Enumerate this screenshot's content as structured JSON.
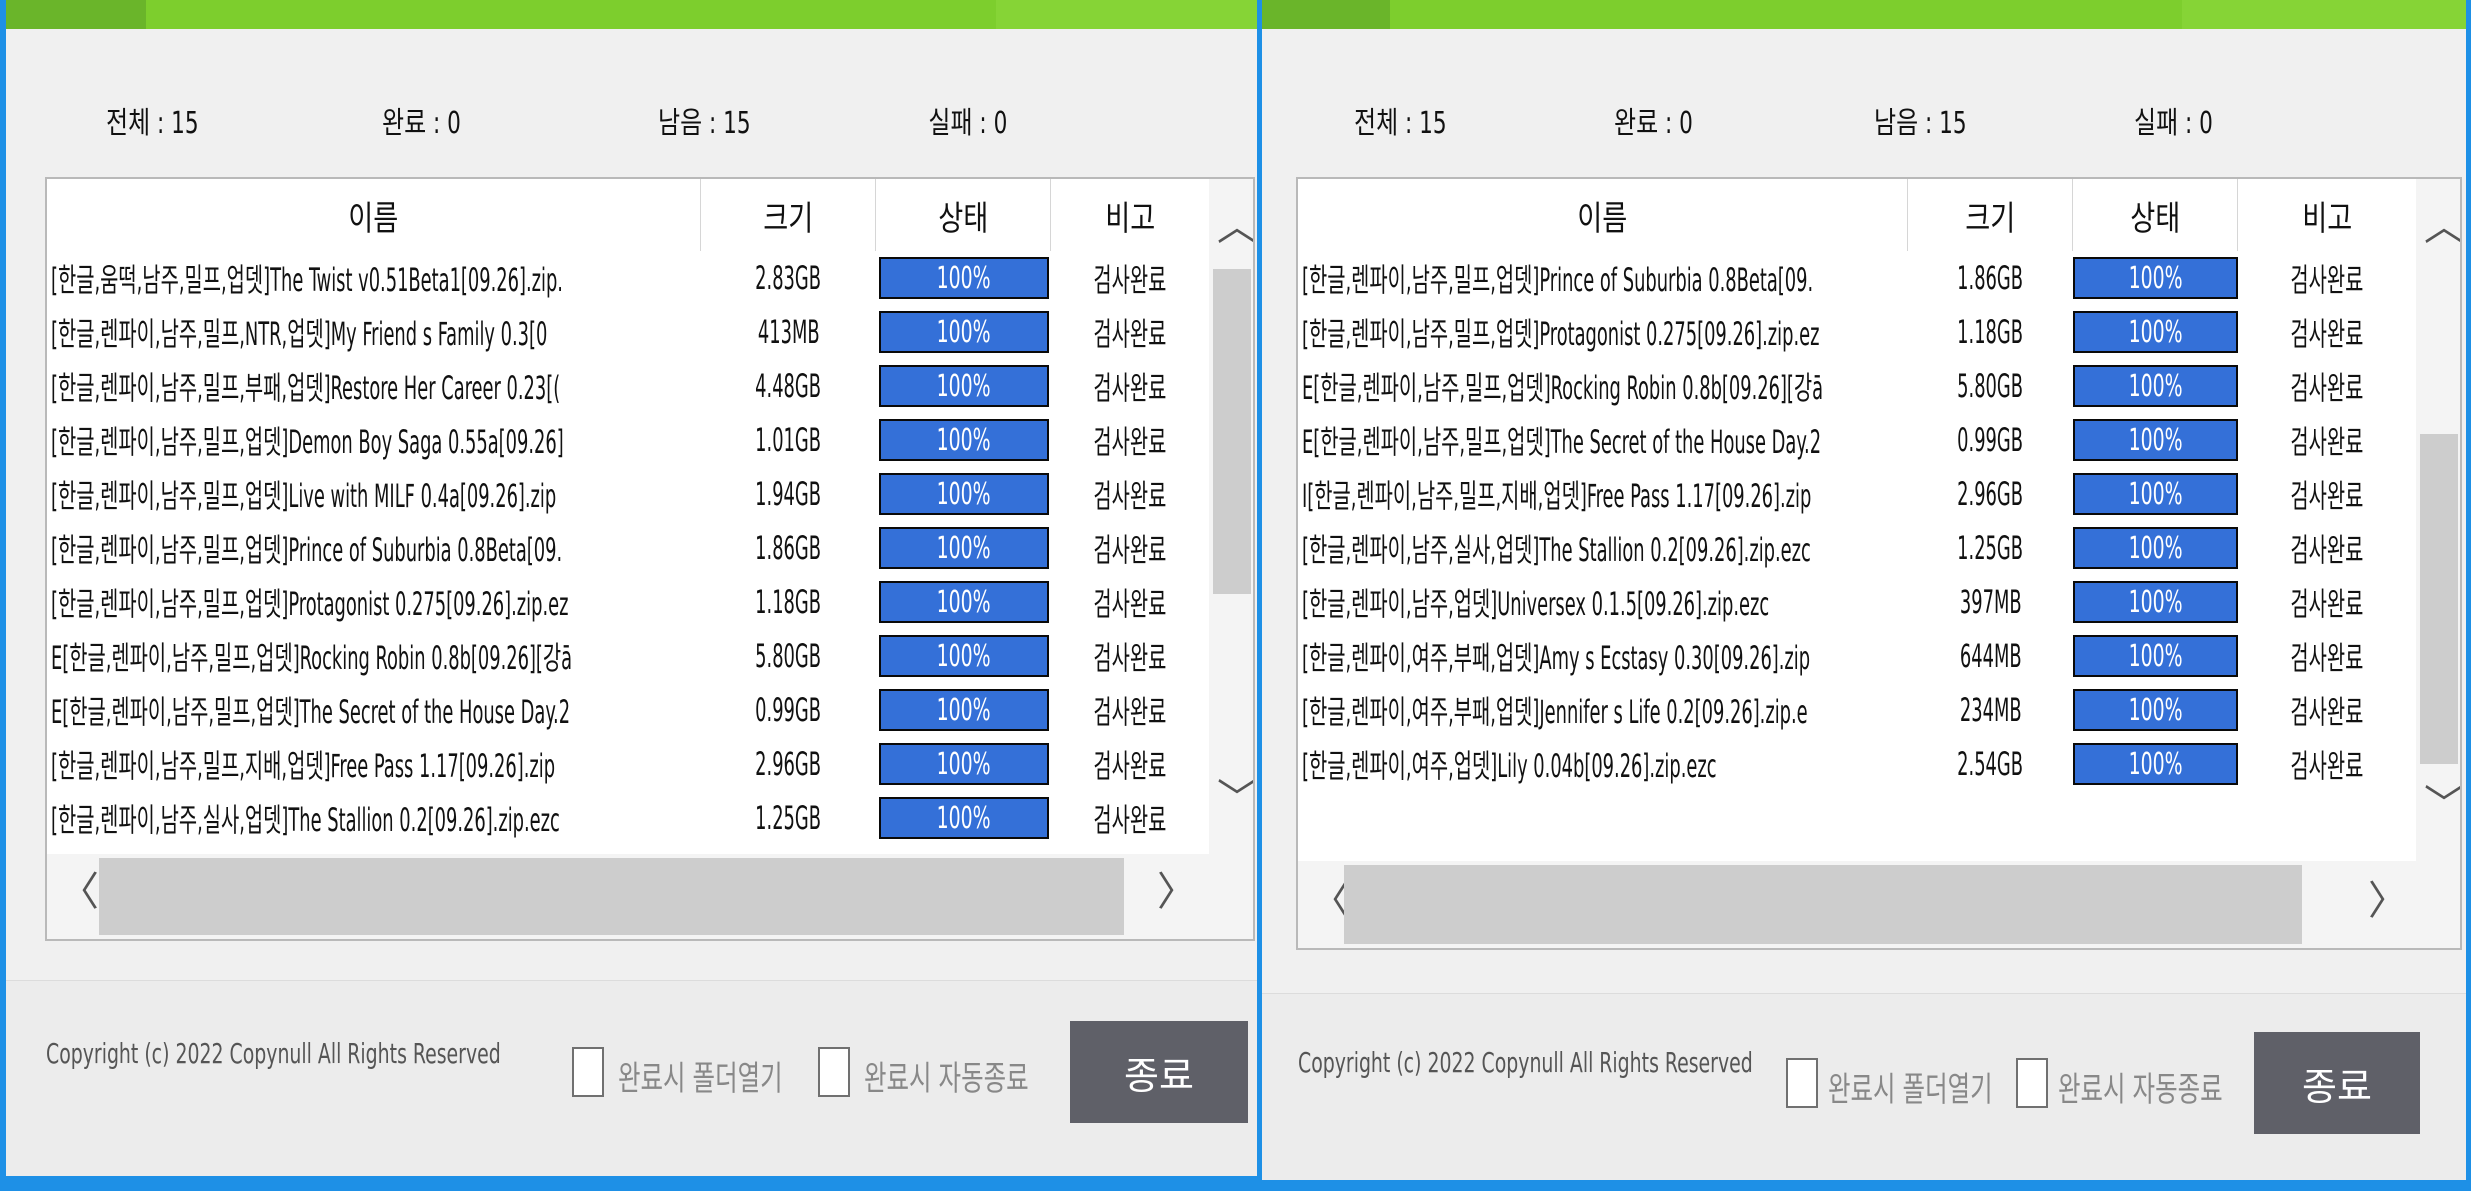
{
  "stats_labels": {
    "total": "전체",
    "done": "완료",
    "remaining": "남음",
    "failed": "실패",
    "sep": ":"
  },
  "columns": {
    "name": "이름",
    "size": "크기",
    "status": "상태",
    "note": "비고"
  },
  "left": {
    "stats": {
      "total": "15",
      "done": "0",
      "remaining": "15",
      "failed": "0"
    },
    "rows": [
      {
        "name": "[한글,움떡,남주,밀프,업뎃]The Twist v0.51Beta1[09.26].zip.",
        "size": "2.83GB",
        "status": "100%",
        "note": "검사완료"
      },
      {
        "name": "[한글,렌파이,남주,밀프,NTR,업뎃]My Friend s Family 0.3[0",
        "size": "413MB",
        "status": "100%",
        "note": "검사완료"
      },
      {
        "name": "[한글,렌파이,남주,밀프,부패,업뎃]Restore Her Career 0.23[(",
        "size": "4.48GB",
        "status": "100%",
        "note": "검사완료"
      },
      {
        "name": "[한글,렌파이,남주,밀프,업뎃]Demon Boy Saga 0.55a[09.26]",
        "size": "1.01GB",
        "status": "100%",
        "note": "검사완료"
      },
      {
        "name": "[한글,렌파이,남주,밀프,업뎃]Live with MILF 0.4a[09.26].zip",
        "size": "1.94GB",
        "status": "100%",
        "note": "검사완료"
      },
      {
        "name": "[한글,렌파이,남주,밀프,업뎃]Prince of Suburbia 0.8Beta[09.",
        "size": "1.86GB",
        "status": "100%",
        "note": "검사완료"
      },
      {
        "name": "[한글,렌파이,남주,밀프,업뎃]Protagonist 0.275[09.26].zip.ez",
        "size": "1.18GB",
        "status": "100%",
        "note": "검사완료"
      },
      {
        "name": "E[한글,렌파이,남주,밀프,업뎃]Rocking Robin 0.8b[09.26][강ā",
        "size": "5.80GB",
        "status": "100%",
        "note": "검사완료"
      },
      {
        "name": "E[한글,렌파이,남주,밀프,업뎃]The Secret of the House Day.2",
        "size": "0.99GB",
        "status": "100%",
        "note": "검사완료"
      },
      {
        "name": "[한글,렌파이,남주,밀프,지배,업뎃]Free Pass 1.17[09.26].zip",
        "size": "2.96GB",
        "status": "100%",
        "note": "검사완료"
      },
      {
        "name": "[한글,렌파이,남주,실사,업뎃]The Stallion 0.2[09.26].zip.ezc",
        "size": "1.25GB",
        "status": "100%",
        "note": "검사완료"
      }
    ]
  },
  "right": {
    "stats": {
      "total": "15",
      "done": "0",
      "remaining": "15",
      "failed": "0"
    },
    "rows": [
      {
        "name": "[한글,렌파이,남주,밀프,업뎃]Prince of Suburbia 0.8Beta[09.",
        "size": "1.86GB",
        "status": "100%",
        "note": "검사완료"
      },
      {
        "name": "[한글,렌파이,남주,밀프,업뎃]Protagonist 0.275[09.26].zip.ez",
        "size": "1.18GB",
        "status": "100%",
        "note": "검사완료"
      },
      {
        "name": "E[한글,렌파이,남주,밀프,업뎃]Rocking Robin 0.8b[09.26][강ā",
        "size": "5.80GB",
        "status": "100%",
        "note": "검사완료"
      },
      {
        "name": "E[한글,렌파이,남주,밀프,업뎃]The Secret of the House Day.2",
        "size": "0.99GB",
        "status": "100%",
        "note": "검사완료"
      },
      {
        "name": "I[한글,렌파이,남주,밀프,지배,업뎃]Free Pass 1.17[09.26].zip",
        "size": "2.96GB",
        "status": "100%",
        "note": "검사완료"
      },
      {
        "name": "[한글,렌파이,남주,실사,업뎃]The Stallion 0.2[09.26].zip.ezc",
        "size": "1.25GB",
        "status": "100%",
        "note": "검사완료"
      },
      {
        "name": "[한글,렌파이,남주,업뎃]Universex 0.1.5[09.26].zip.ezc",
        "size": "397MB",
        "status": "100%",
        "note": "검사완료"
      },
      {
        "name": "[한글,렌파이,여주,부패,업뎃]Amy s Ecstasy 0.30[09.26].zip",
        "size": "644MB",
        "status": "100%",
        "note": "검사완료"
      },
      {
        "name": "[한글,렌파이,여주,부패,업뎃]Jennifer s Life 0.2[09.26].zip.e",
        "size": "234MB",
        "status": "100%",
        "note": "검사완료"
      },
      {
        "name": "[한글,렌파이,여주,업뎃]Lily 0.04b[09.26].zip.ezc",
        "size": "2.54GB",
        "status": "100%",
        "note": "검사완료"
      }
    ]
  },
  "footer": {
    "copyright": "Copyright (c) 2022 Copynull All Rights Reserved",
    "open_folder_label": "완료시 폴더열기",
    "auto_exit_label": "완료시 자동종료",
    "close_label": "종료"
  },
  "icons": {
    "scroll_up": "chevron-up-icon",
    "scroll_down": "chevron-down-icon",
    "scroll_left": "chevron-left-icon",
    "scroll_right": "chevron-right-icon"
  },
  "colors": {
    "title_bar": "#7dce2d",
    "progress": "#3470d8",
    "close_button": "#5f6068",
    "desktop": "#1e90e6"
  }
}
